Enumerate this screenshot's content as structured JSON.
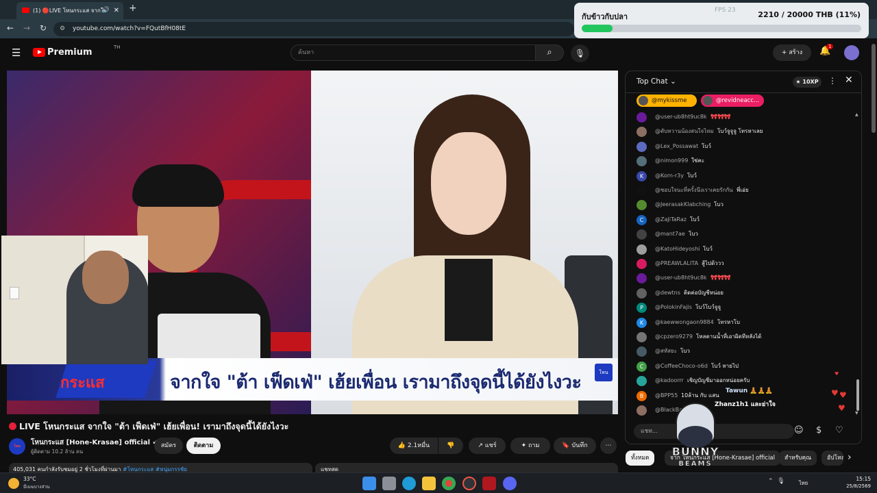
{
  "browser": {
    "tab_title": "(1) 🔴LIVE โหนกระแส จากใจ",
    "url": "youtube.com/watch?v=FQutBfH08tE"
  },
  "overlay": {
    "title": "กับข้าวกับปลา",
    "amount": "2210 / 20000 THB (11%)",
    "progress": 0.11,
    "fps_label": "FPS 23"
  },
  "header": {
    "brand": "Premium",
    "region": "TH",
    "search_placeholder": "ค้นหา",
    "create_label": "สร้าง",
    "notification_count": "1"
  },
  "video": {
    "banner_text": "จากใจ \"ต้า เฟ็ดเฟ่\" เฮ้ยเพื่อน เรามาถึงจุดนี้ได้ยังไงวะ",
    "banner_logo": "กระแส",
    "corner_logo": "โหน"
  },
  "meta": {
    "title": "LIVE โหนกระแส จากใจ \"ต้า เฟ็ดเฟ่\" เฮ้ยเพื่อน! เรามาถึงจุดนี้ได้ยังไงวะ",
    "channel": "โหนกระแส [Hone-Krasae] official",
    "subscribers": "ผู้ติดตาม 10.2 ล้าน คน",
    "join": "สมัคร",
    "subscribed": "ติดตาม",
    "likes": "2.1หมื่น",
    "share": "แชร์",
    "ask": "ถาม",
    "save": "บันทึก",
    "desc_views": "405,031 คนกำลังรับชมอยู่ 2 ชั่วโมงที่ผ่านมา",
    "desc_tags": "#โหนกระแส #หนุ่มกรรชัย",
    "desc2": "แชทสด"
  },
  "chat": {
    "title": "Top Chat",
    "xp": "10XP",
    "tickers": [
      "@mykissme",
      "@revidneacc..."
    ],
    "input_placeholder": "แชท...",
    "messages": [
      {
        "author": "@user-ub8ht9uc8k",
        "text": "🎀🎀🎀",
        "initial": "",
        "color": "#6a1b9a"
      },
      {
        "author": "@ดับหวานน้องสนใจไหม",
        "text": "โบว์จูจูจู โทรหาเลย",
        "initial": "",
        "color": "#8d6e63"
      },
      {
        "author": "@Lex_Possawat",
        "text": "โบว์",
        "initial": "",
        "color": "#5c6bc0"
      },
      {
        "author": "@nimon999",
        "text": "ใช่คะ",
        "initial": "",
        "color": "#546e7a"
      },
      {
        "author": "@Korn-r3y",
        "text": "โบว์",
        "initial": "K",
        "color": "#3949ab"
      },
      {
        "author": "@ชอบใจนะที่ครั้งนึงเราเคยรักกัน",
        "text": "พี่เอ่ย",
        "initial": "",
        "color": "#111111"
      },
      {
        "author": "@JeerasakKlabching",
        "text": "โบว",
        "initial": "",
        "color": "#558b2f"
      },
      {
        "author": "@ZaJiTaRaz",
        "text": "โบว์",
        "initial": "C",
        "color": "#1565c0"
      },
      {
        "author": "@mant7ae",
        "text": "โบว",
        "initial": "",
        "color": "#424242"
      },
      {
        "author": "@KatoHideyoshi",
        "text": "โบว์",
        "initial": "",
        "color": "#9e9e9e"
      },
      {
        "author": "@PREAWLALITA",
        "text": "สู้ไปด้ววว",
        "initial": "",
        "color": "#d81b60"
      },
      {
        "author": "@user-ub8ht9uc8k",
        "text": "🎀🎀🎀",
        "initial": "",
        "color": "#6a1b9a"
      },
      {
        "author": "@dewtns",
        "text": "ติดต่อบัญชีหน่อย",
        "initial": "",
        "color": "#616161"
      },
      {
        "author": "@PolokinFajis",
        "text": "โบว์โบว์จูจู",
        "initial": "P",
        "color": "#00897b"
      },
      {
        "author": "@kaewwongaon9884",
        "text": "โทรหาโบ",
        "initial": "K",
        "color": "#1e88e5"
      },
      {
        "author": "@cpzero9279",
        "text": "โหลดานน้ำที่เอาผิดทีหลังได้",
        "initial": "",
        "color": "#757575"
      },
      {
        "author": "@สหัสยะ",
        "text": "โบว",
        "initial": "",
        "color": "#455a64"
      },
      {
        "author": "@CoffeeChoco-o6d",
        "text": "โบว์ หายไป",
        "initial": "C",
        "color": "#43a047"
      },
      {
        "author": "@kadoorrr",
        "text": "เชิญบัญชีมาออกหน่อยครับ",
        "initial": "",
        "color": "#26a69a"
      },
      {
        "author": "@BPP55",
        "text": "10ล้าน กับ แสน",
        "initial": "B",
        "color": "#ef6c00"
      },
      {
        "author": "@BlackBat",
        "text": "โบว์",
        "initial": "",
        "color": "#8d6e63"
      }
    ],
    "floating": [
      "Tawun 🧘🧘🧘",
      "Zhanz1h1 และย่าใจ"
    ]
  },
  "chips": [
    "ทั้งหมด",
    "จาก โหนกระแส [Hone-Krasae] official",
    "สำหรับคุณ",
    "อัปโหลด"
  ],
  "watermark": {
    "line1": "BUNNY",
    "line2": "BEAMS"
  },
  "taskbar": {
    "temp": "33°C",
    "weather": "มีเมฆบางส่วน",
    "lang": "ไทย",
    "time": "15:15",
    "date": "25/8/2569"
  },
  "colors": {
    "yt_red": "#ff0000",
    "live_red": "#e5203a",
    "progress_green": "#22c55e",
    "ticker_gold": "#ffb300",
    "ticker_pink": "#e91e63"
  }
}
